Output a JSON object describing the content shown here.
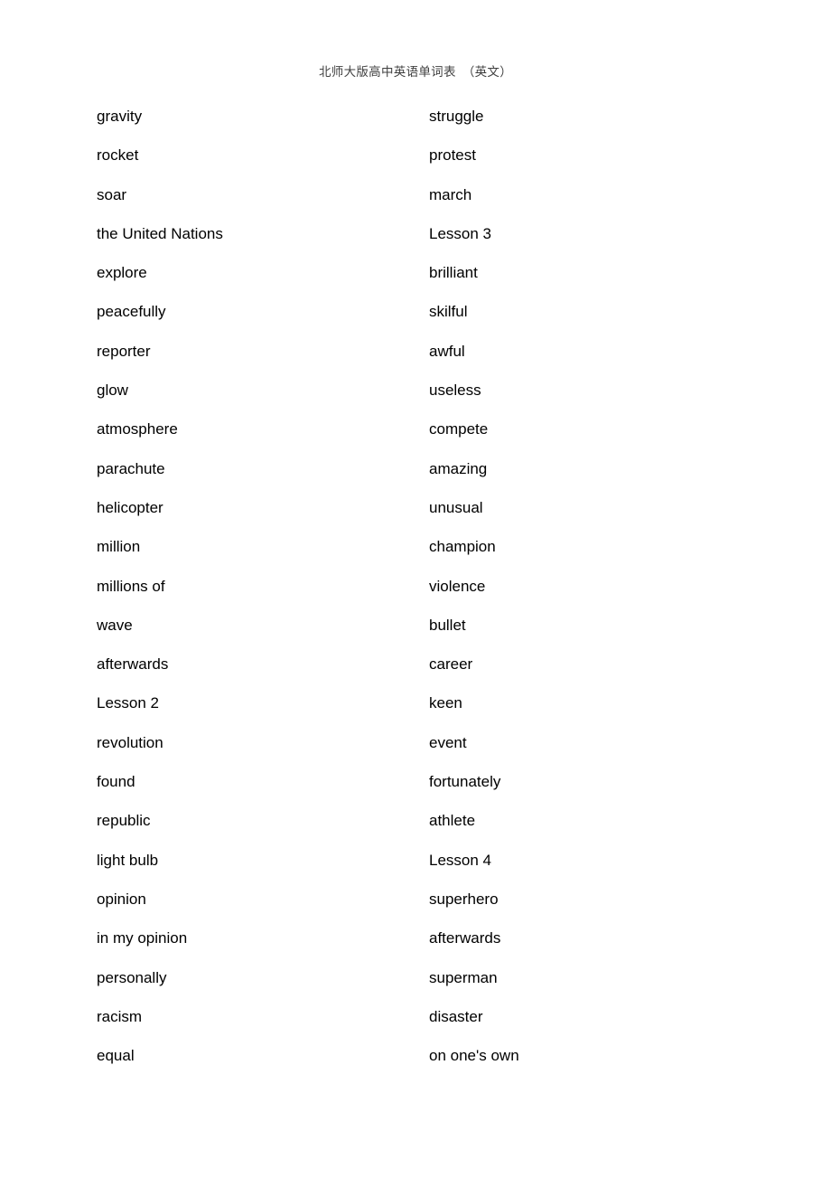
{
  "header": {
    "title": "北师大版高中英语单词表　（英文）"
  },
  "word_list": {
    "columns": 2,
    "rows": [
      {
        "left": "gravity",
        "right": "struggle"
      },
      {
        "left": "rocket",
        "right": "protest"
      },
      {
        "left": "soar",
        "right": "march"
      },
      {
        "left": "the United Nations",
        "right": "Lesson 3"
      },
      {
        "left": "explore",
        "right": "brilliant"
      },
      {
        "left": "peacefully",
        "right": "skilful"
      },
      {
        "left": "reporter",
        "right": "awful"
      },
      {
        "left": "glow",
        "right": "useless"
      },
      {
        "left": "atmosphere",
        "right": "compete"
      },
      {
        "left": "parachute",
        "right": "amazing"
      },
      {
        "left": "helicopter",
        "right": "unusual"
      },
      {
        "left": "million",
        "right": "champion"
      },
      {
        "left": "millions of",
        "right": "violence"
      },
      {
        "left": "wave",
        "right": "bullet"
      },
      {
        "left": "afterwards",
        "right": "career"
      },
      {
        "left": "Lesson 2",
        "right": "keen"
      },
      {
        "left": "revolution",
        "right": "event"
      },
      {
        "left": "found",
        "right": "fortunately"
      },
      {
        "left": "republic",
        "right": "athlete"
      },
      {
        "left": "light bulb",
        "right": "Lesson 4"
      },
      {
        "left": "opinion",
        "right": "superhero"
      },
      {
        "left": "in my opinion",
        "right": "afterwards"
      },
      {
        "left": "personally",
        "right": "superman"
      },
      {
        "left": "racism",
        "right": "disaster"
      },
      {
        "left": "equal",
        "right": "on one's own"
      }
    ]
  }
}
